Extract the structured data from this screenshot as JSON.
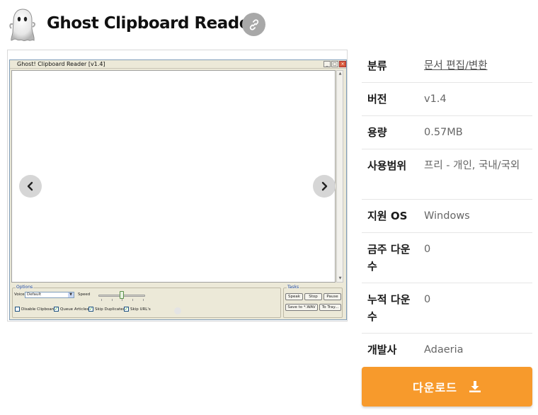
{
  "header": {
    "title": "Ghost Clipboard Reader",
    "app_icon": "ghost-icon",
    "link_icon": "link-icon"
  },
  "screenshot": {
    "window_title": "Ghost! Clipboard Reader [v1.4]",
    "options_label": "Options",
    "voice_label": "Voice",
    "voice_value": "Default",
    "speed_label": "Speed",
    "speed_level": 0.5,
    "tasks_label": "Tasks",
    "buttons": [
      "Speak",
      "Stop",
      "Pause",
      "Save to *.WAV",
      "To Tray..."
    ],
    "checkboxes": [
      {
        "label": "Disable Clipboard",
        "checked": false
      },
      {
        "label": "Queue Articles",
        "checked": true
      },
      {
        "label": "Skip Duplicates",
        "checked": true
      },
      {
        "label": "Skip URL's",
        "checked": true
      }
    ],
    "prev_icon": "chevron-left-icon",
    "next_icon": "chevron-right-icon"
  },
  "info": {
    "rows": [
      {
        "key": "분류",
        "value": "문서 편집/변환",
        "link": true
      },
      {
        "key": "버전",
        "value": "v1.4"
      },
      {
        "key": "용량",
        "value": "0.57MB"
      },
      {
        "key": "사용범위",
        "value": "프리 - 개인, 국내/국외"
      },
      {
        "key": "지원 OS",
        "value": "Windows"
      },
      {
        "key": "금주 다운수",
        "value": "0"
      },
      {
        "key": "누적 다운수",
        "value": "0"
      },
      {
        "key": "개발사",
        "value": "Adaeria"
      }
    ]
  },
  "download": {
    "label": "다운로드",
    "icon": "download-icon",
    "color": "#F79A2C"
  }
}
